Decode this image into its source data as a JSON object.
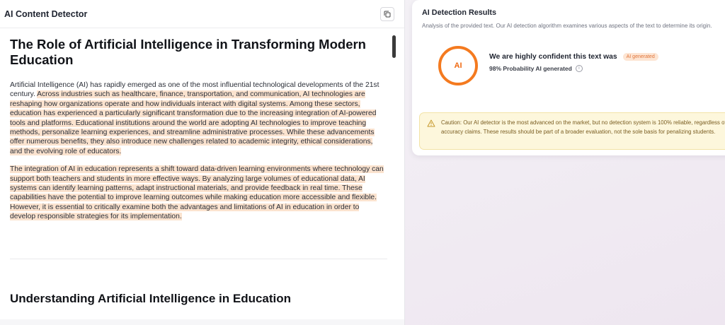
{
  "app": {
    "title": "AI Content Detector"
  },
  "document": {
    "heading1": "The Role of Artificial Intelligence in Transforming Modern Education",
    "para1_plain": "Artificial Intelligence (AI) has rapidly emerged as one of the most influential technological developments of the 21st century. ",
    "para1_highlight": "Across industries such as healthcare, finance, transportation, and communication, AI technologies are reshaping how organizations operate and how individuals interact with digital systems. Among these sectors, education has experienced a particularly significant transformation due to the increasing integration of AI-powered tools and platforms. Educational institutions around the world are adopting AI technologies to improve teaching methods, personalize learning experiences, and streamline administrative processes. While these advancements offer numerous benefits, they also introduce new challenges related to academic integrity, ethical considerations, and the evolving role of educators.",
    "para2_highlight": "The integration of AI in education represents a shift toward data-driven learning environments where technology can support both teachers and students in more effective ways. By analyzing large volumes of educational data, AI systems can identify learning patterns, adapt instructional materials, and provide feedback in real time. These capabilities have the potential to improve learning outcomes while making education more accessible and flexible. However, it is essential to critically examine both the advantages and limitations of AI in education in order to develop responsible strategies for its implementation.",
    "heading2": "Understanding Artificial Intelligence in Education"
  },
  "results": {
    "title": "AI Detection Results",
    "description": "Analysis of the provided text. Our AI detection algorithm examines various aspects of the text to determine its origin.",
    "ring_label": "AI",
    "verdict": "We are highly confident this text was",
    "badge": "AI generated",
    "probability": "98% Probability AI generated",
    "caution": "Caution: Our AI detector is the most advanced on the market, but no detection system is 100% reliable, regardless of accuracy claims. These results should be part of a broader evaluation, not the sole basis for penalizing students."
  },
  "icons": {
    "copy": "copy-icon",
    "info": "info-icon",
    "warning": "warning-icon"
  },
  "colors": {
    "accent_orange": "#f47a1f",
    "highlight": "#fbe3cf",
    "caution_bg": "#fdf7dc"
  }
}
